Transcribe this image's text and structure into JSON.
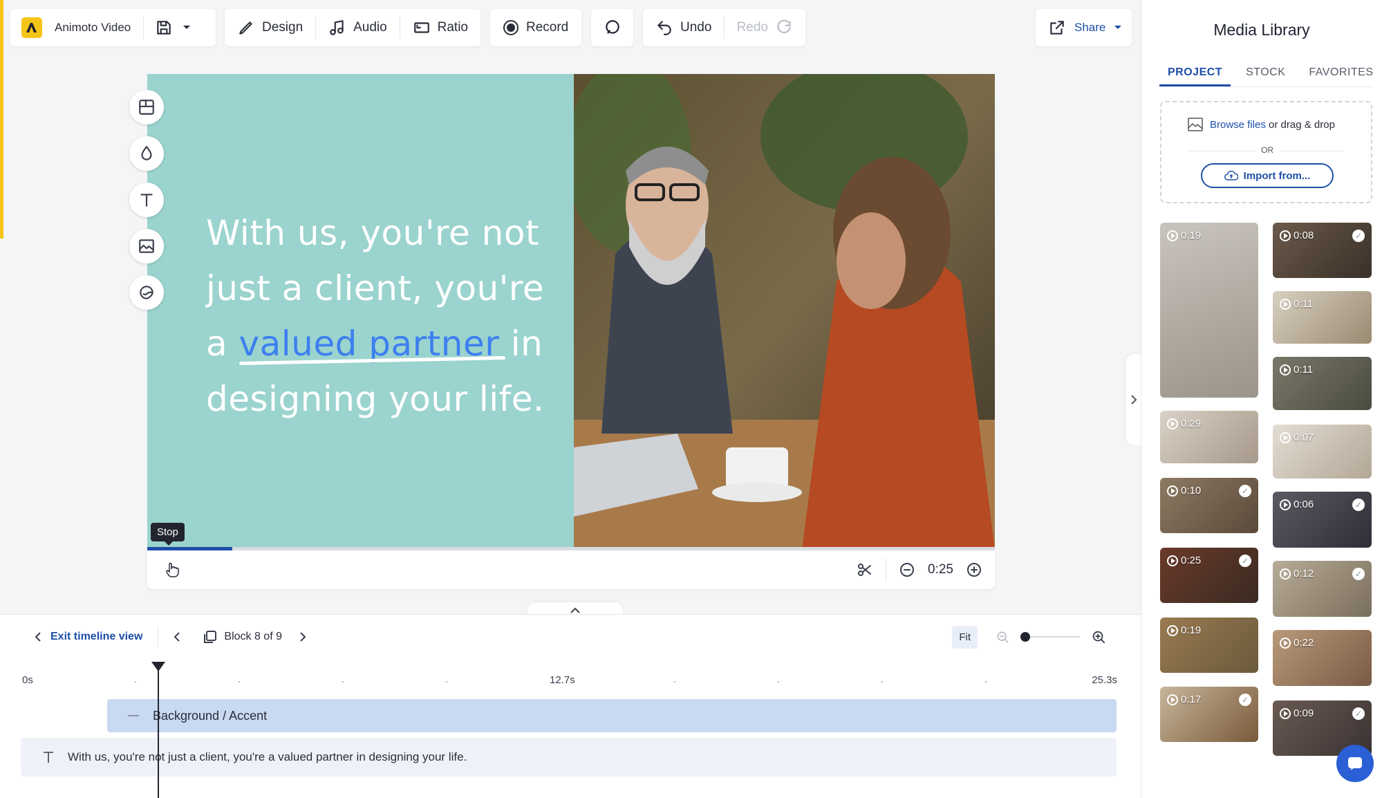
{
  "toolbar": {
    "project_name": "Animoto Video",
    "design": "Design",
    "audio": "Audio",
    "ratio": "Ratio",
    "record": "Record",
    "undo": "Undo",
    "redo": "Redo",
    "share": "Share"
  },
  "slide": {
    "text_before": "With us, you're not just a client, you're a ",
    "text_highlight": "valued partner",
    "text_after": " in designing your life.",
    "background_color": "#9bd3ce",
    "highlight_color": "#3d7ff0"
  },
  "player": {
    "tooltip": "Stop",
    "duration": "0:25",
    "progress": 0.1
  },
  "timeline": {
    "exit_label": "Exit timeline view",
    "block_label": "Block 8 of 9",
    "fit_label": "Fit",
    "zoom_level": 0.0,
    "ruler": [
      "0s",
      "12.7s",
      "25.3s"
    ],
    "tracks": [
      {
        "label": "Background / Accent"
      },
      {
        "label": "With us, you're not just a client, you're a valued partner in designing your life."
      }
    ]
  },
  "media_library": {
    "title": "Media Library",
    "tabs": [
      "PROJECT",
      "STOCK",
      "FAVORITES"
    ],
    "active_tab": "PROJECT",
    "browse_link": "Browse files",
    "browse_suffix": " or drag & drop",
    "or_label": "OR",
    "import_label": "Import from...",
    "thumbnails": [
      {
        "duration": "0:19",
        "checked": false
      },
      {
        "duration": "0:08",
        "checked": true
      },
      {
        "duration": "0:11",
        "checked": false
      },
      {
        "duration": "0:11",
        "checked": false
      },
      {
        "duration": "0:29",
        "checked": false
      },
      {
        "duration": "0:07",
        "checked": false
      },
      {
        "duration": "0:10",
        "checked": true
      },
      {
        "duration": "0:06",
        "checked": true
      },
      {
        "duration": "0:25",
        "checked": true
      },
      {
        "duration": "0:12",
        "checked": true
      },
      {
        "duration": "0:19",
        "checked": false
      },
      {
        "duration": "0:22",
        "checked": false
      },
      {
        "duration": "0:17",
        "checked": true
      },
      {
        "duration": "0:09",
        "checked": true
      }
    ]
  },
  "colors": {
    "accent": "#1e4fa8",
    "brand_yellow": "#f5c518"
  }
}
